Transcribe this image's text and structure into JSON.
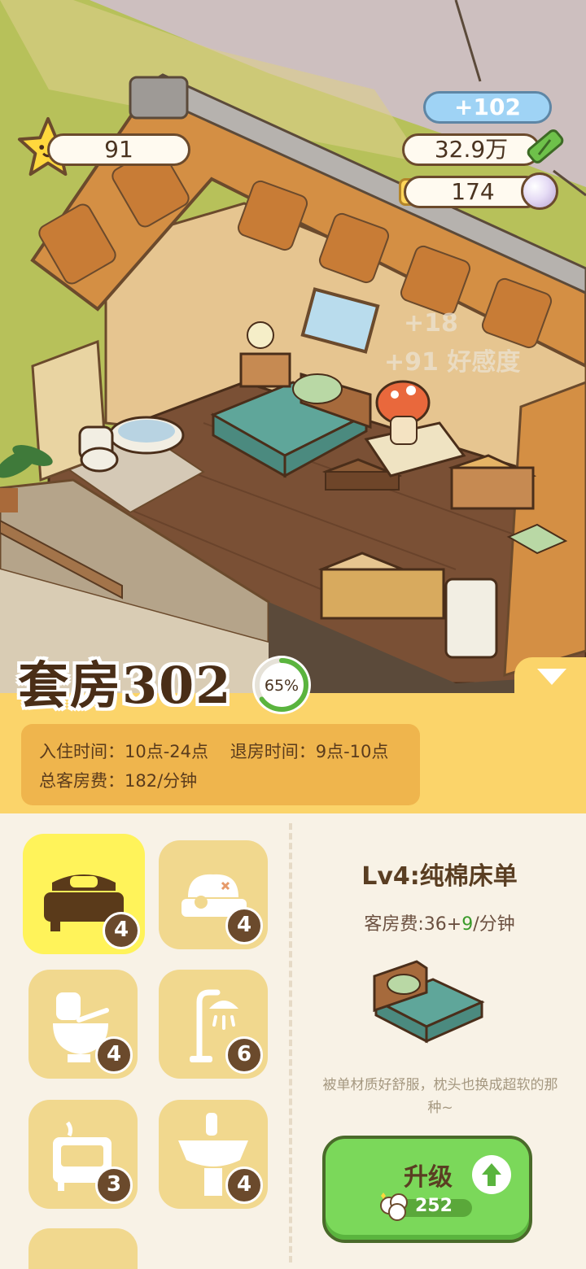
{
  "hud": {
    "stars": "91",
    "floating_reward": "+102",
    "bamboo": "32.9万",
    "pearls": "174",
    "floating_text_1": "+18",
    "floating_text_2": "+91 好感度"
  },
  "room": {
    "title": "套房302",
    "progress_text": "65%",
    "progress_value": 0.65,
    "checkin_label": "入住时间：10点-24点",
    "checkout_label": "退房时间：9点-10点",
    "fee_label": "总客房费：182/分钟"
  },
  "items": [
    {
      "name": "bed",
      "level": "4",
      "selected": true
    },
    {
      "name": "nightstand",
      "level": "4",
      "selected": false
    },
    {
      "name": "toilet",
      "level": "4",
      "selected": false
    },
    {
      "name": "shower",
      "level": "6",
      "selected": false
    },
    {
      "name": "cabinet",
      "level": "3",
      "selected": false
    },
    {
      "name": "sink",
      "level": "4",
      "selected": false
    }
  ],
  "detail": {
    "title": "Lv4:纯棉床单",
    "fee_prefix": "客房费:36+",
    "fee_bonus": "9",
    "fee_suffix": "/分钟",
    "description": "被单材质好舒服，枕头也换成超软的那种~"
  },
  "upgrade": {
    "label": "升级",
    "cost": "252"
  },
  "colors": {
    "accent_yellow": "#fbd46a",
    "tile_bg": "#f1d88e",
    "selected_tile": "#fff35a",
    "upgrade_green": "#7bd85a",
    "bonus_green": "#3a9a2a"
  }
}
